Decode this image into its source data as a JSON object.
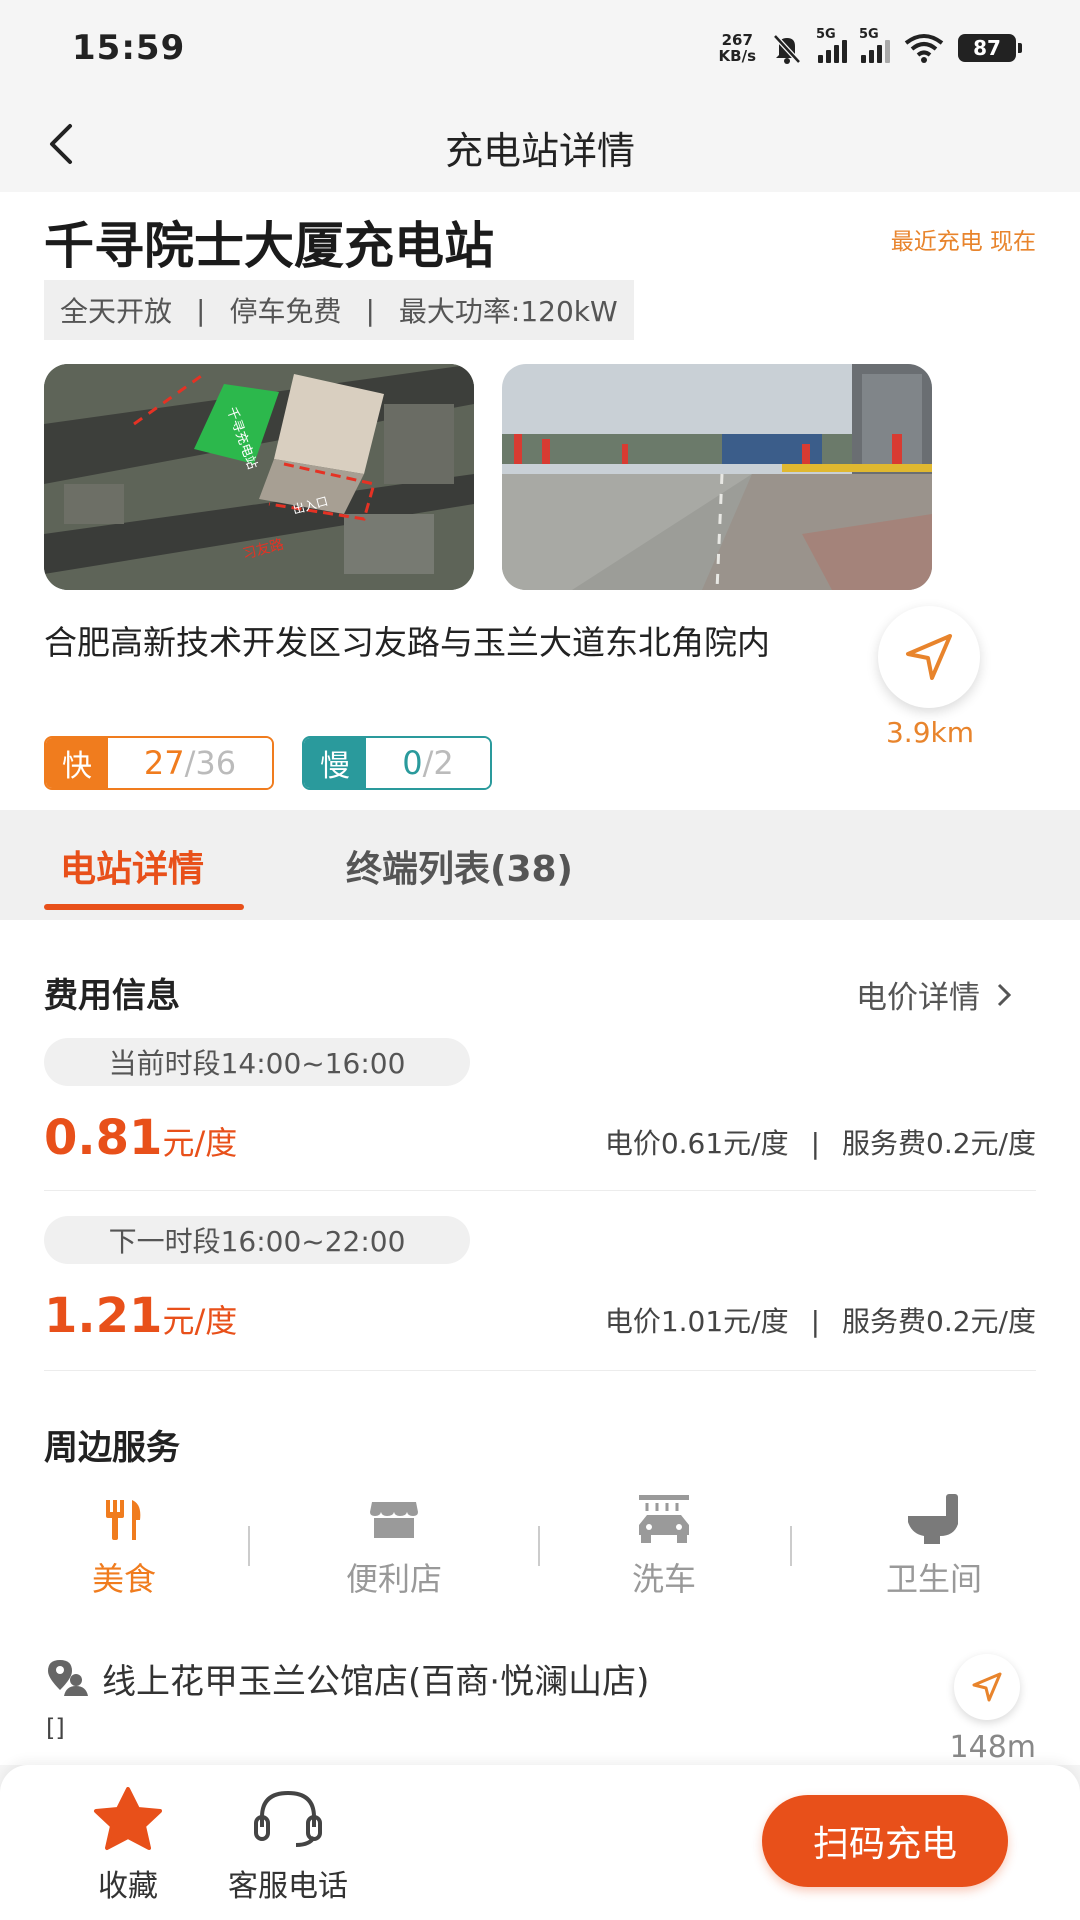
{
  "status_bar": {
    "time": "15:59",
    "net_speed_value": "267",
    "net_speed_unit": "KB/s",
    "sim1": "5G",
    "sim2": "5G",
    "battery": "87",
    "icons": [
      "mute-bell-icon",
      "signal-icon",
      "wifi-icon",
      "battery-icon"
    ]
  },
  "header": {
    "title": "充电站详情",
    "back_icon": "back-arrow-icon"
  },
  "station": {
    "name": "千寻院士大厦充电站",
    "recent_label": "最近充电 现在",
    "tags": [
      "全天开放",
      "停车免费",
      "最大功率:120kW"
    ],
    "tag_separator": "|",
    "photo1_labels": {
      "building": "千寻充电站",
      "entrance": "出入口",
      "road": "习友路"
    },
    "address": "合肥高新技术开发区习友路与玉兰大道东北角院内",
    "distance": "3.9km",
    "fast": {
      "label": "快",
      "available": "27",
      "total": "/36"
    },
    "slow": {
      "label": "慢",
      "available": "0",
      "total": "/2"
    }
  },
  "tabs": {
    "active": "电站详情",
    "terminals": "终端列表(38)"
  },
  "fees": {
    "title": "费用信息",
    "detail_link": "电价详情",
    "current": {
      "period": "当前时段14:00~16:00",
      "price": "0.81",
      "unit": "元/度",
      "electricity": "电价0.61元/度",
      "service": "服务费0.2元/度"
    },
    "next": {
      "period": "下一时段16:00~22:00",
      "price": "1.21",
      "unit": "元/度",
      "electricity": "电价1.01元/度",
      "service": "服务费0.2元/度"
    },
    "separator": "|"
  },
  "services": {
    "title": "周边服务",
    "items": [
      {
        "label": "美食",
        "icon": "fork-knife-icon",
        "active": true
      },
      {
        "label": "便利店",
        "icon": "store-icon",
        "active": false
      },
      {
        "label": "洗车",
        "icon": "car-wash-icon",
        "active": false
      },
      {
        "label": "卫生间",
        "icon": "toilet-icon",
        "active": false
      }
    ],
    "poi": {
      "name": "线上花甲玉兰公馆店(百商·悦澜山店)",
      "sub": "[]",
      "distance": "148m"
    }
  },
  "bottom_bar": {
    "favorite": "收藏",
    "service_phone": "客服电话",
    "scan": "扫码充电"
  },
  "colors": {
    "accent": "#e8501a",
    "orange": "#f07c1e",
    "teal": "#2a9a9c"
  }
}
